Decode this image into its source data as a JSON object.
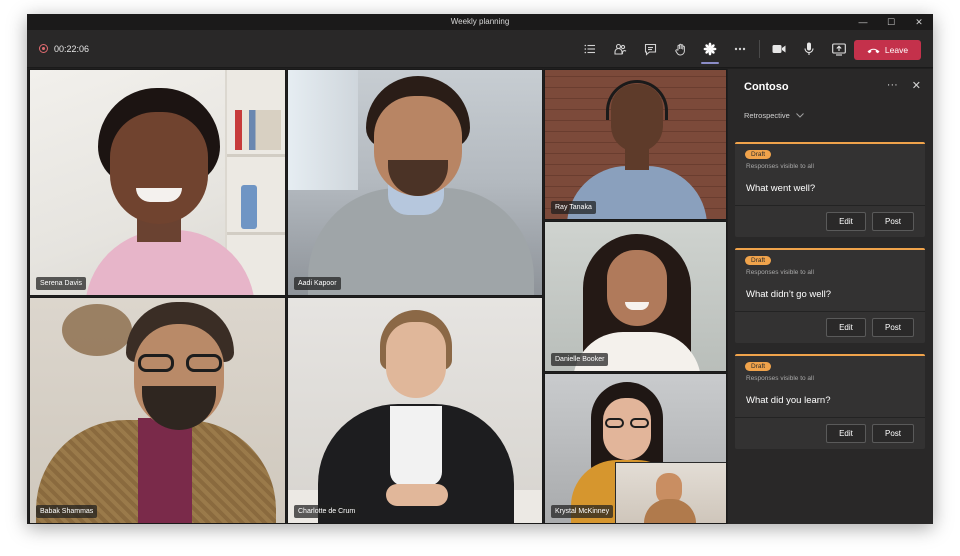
{
  "window": {
    "title": "Weekly planning",
    "controls": [
      "—",
      "☐",
      "✕"
    ]
  },
  "toolbar": {
    "timer": "00:22:06",
    "leave_label": "Leave",
    "tools": [
      "participants-list-icon",
      "people-icon",
      "chat-icon",
      "raise-hand-icon",
      "apps-icon",
      "more-icon",
      "camera-icon",
      "mic-icon",
      "share-icon"
    ]
  },
  "participants": [
    {
      "name": "Serena Davis"
    },
    {
      "name": "Aadi Kapoor"
    },
    {
      "name": "Ray Tanaka"
    },
    {
      "name": "Danielle Booker"
    },
    {
      "name": "Babak Shammas"
    },
    {
      "name": "Charlotte de Crum"
    },
    {
      "name": "Krystal McKinney"
    }
  ],
  "panel": {
    "title": "Contoso",
    "more": "···",
    "close": "✕",
    "dropdown": "Retrospective",
    "cards": [
      {
        "badge": "Draft",
        "visibility": "Responses visible to all",
        "question": "What went well?",
        "edit": "Edit",
        "post": "Post"
      },
      {
        "badge": "Draft",
        "visibility": "Responses visible to all",
        "question": "What didn’t go well?",
        "edit": "Edit",
        "post": "Post"
      },
      {
        "badge": "Draft",
        "visibility": "Responses visible to all",
        "question": "What did you learn?",
        "edit": "Edit",
        "post": "Post"
      }
    ]
  },
  "colors": {
    "accent": "#f0a34b",
    "leave": "#c4314b",
    "active_tab": "#8b8cc7"
  }
}
